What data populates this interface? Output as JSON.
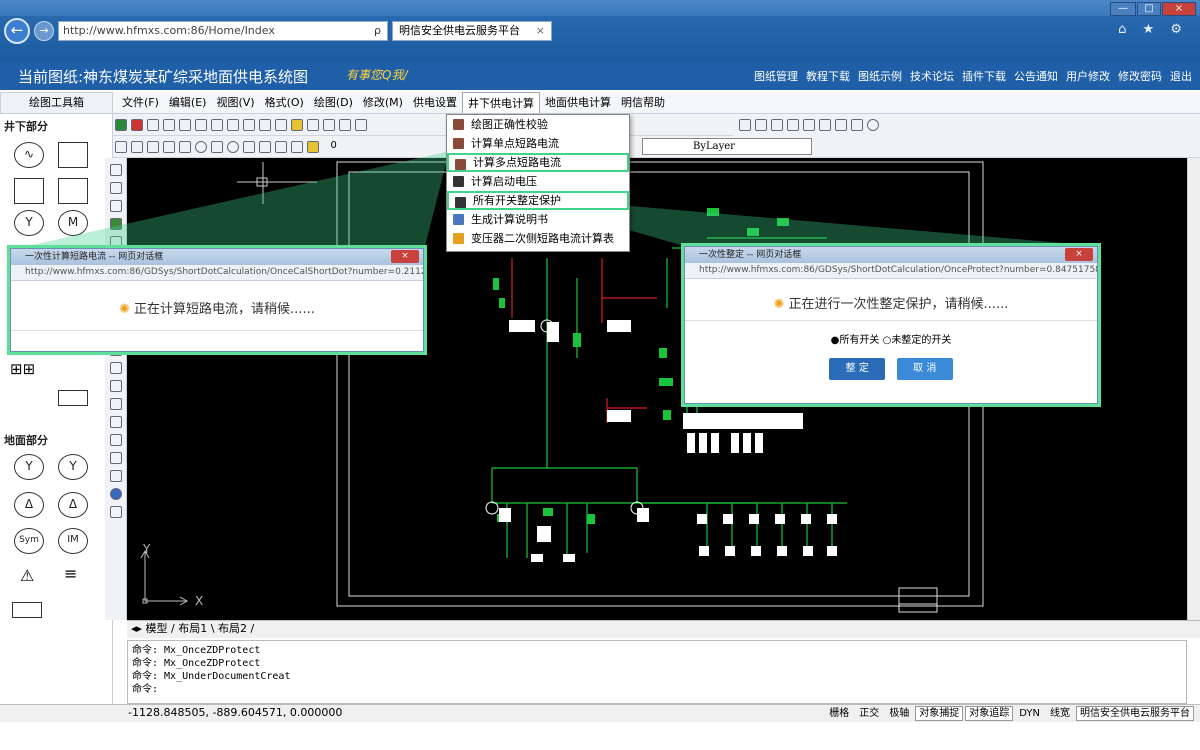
{
  "browser": {
    "url": "http://www.hfmxs.com:86/Home/Index",
    "tab_title": "明信安全供电云服务平台",
    "tab_close": "×",
    "search_glyph": "ρ",
    "nav_icons": "⌂ ★ ⚙",
    "window_controls": [
      "—",
      "□",
      "×"
    ]
  },
  "header": {
    "drawing_title": "当前图纸:神东煤炭某矿综采地面供电系统图",
    "logo_text": "有事您Q我/",
    "links": [
      "图纸管理",
      "教程下载",
      "图纸示例",
      "技术论坛",
      "插件下载",
      "公告通知",
      "用户修改",
      "修改密码",
      "退出"
    ]
  },
  "toolbox": {
    "title": "绘图工具箱",
    "section_underground": "井下部分",
    "section_surface": "地面部分",
    "symbols": [
      "Y",
      "M",
      "Y",
      "Y",
      "Δ",
      "Δ",
      "Sym",
      "IM",
      "≡"
    ]
  },
  "menubar": {
    "items": [
      "文件(F)",
      "编辑(E)",
      "视图(V)",
      "格式(O)",
      "绘图(D)",
      "修改(M)",
      "供电设置",
      "井下供电计算",
      "地面供电计算",
      "明信帮助"
    ],
    "active_index": 7
  },
  "layer": {
    "current": "0",
    "linetype": "ByLayer"
  },
  "dropdown": {
    "items": [
      "绘图正确性校验",
      "计算单点短路电流",
      "计算多点短路电流",
      "计算启动电压",
      "所有开关整定保护",
      "生成计算说明书",
      "变压器二次侧短路电流计算表"
    ],
    "highlighted": [
      2,
      4
    ]
  },
  "dialog_left": {
    "title": "一次性计算短路电流 -- 网页对话框",
    "url": "http://www.hfmxs.com:86/GDSys/ShortDotCalculation/OnceCalShortDot?number=0.21127203242",
    "message": "正在计算短路电流，请稍候......",
    "close": "×"
  },
  "dialog_right": {
    "title": "一次性整定 -- 网页对话框",
    "url": "http://www.hfmxs.com:86/GDSys/ShortDotCalculation/OnceProtect?number=0.8475175855307271",
    "message": "正在进行一次性整定保护，请稍候......",
    "radio_all": "●所有开关",
    "radio_unset": "○未整定的开关",
    "btn_confirm": "整 定",
    "btn_cancel": "取 消",
    "close": "×"
  },
  "canvas": {
    "axis_y": "Y",
    "axis_x": "X"
  },
  "layout_tabs": {
    "model": "模型",
    "layout1": "布局1",
    "layout2": "布局2"
  },
  "command": {
    "lines": [
      "命令: Mx_OnceZDProtect",
      "命令: Mx_OnceZDProtect",
      "命令: Mx_UnderDocumentCreat",
      "命令:"
    ]
  },
  "status": {
    "coords": "-1128.848505, -889.604571, 0.000000",
    "toggles": [
      "栅格",
      "正交",
      "极轴",
      "对象捕捉",
      "对象追踪",
      "DYN",
      "线宽",
      "明信安全供电云服务平台"
    ],
    "on": [
      3,
      4,
      7
    ]
  },
  "colors": {
    "accent": "#1f5fa8",
    "highlight": "#3fd48a",
    "wire_green": "#19c43b",
    "wire_red": "#d22020"
  }
}
